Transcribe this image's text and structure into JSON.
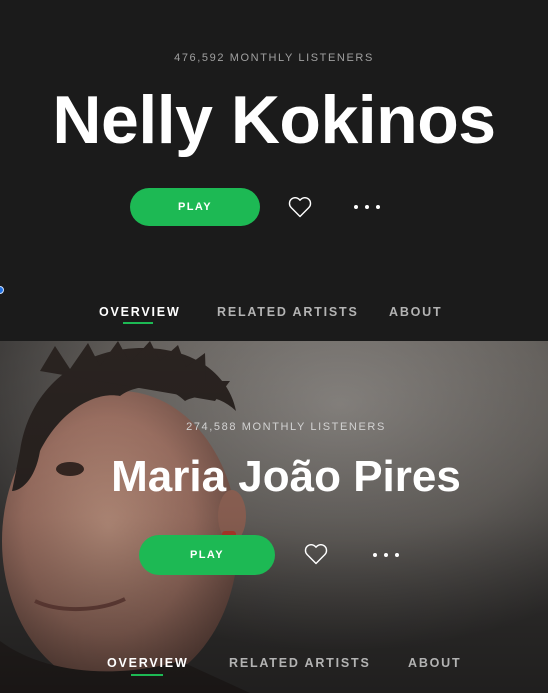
{
  "artists": [
    {
      "monthly_listeners": "476,592 MONTHLY LISTENERS",
      "name": "Nelly Kokinos",
      "play_label": "PLAY",
      "heart_icon": "heart-outline-icon",
      "more_icon": "more-dots-icon",
      "tabs": [
        {
          "label": "OVERVIEW",
          "active": true
        },
        {
          "label": "RELATED ARTISTS",
          "active": false
        },
        {
          "label": "ABOUT",
          "active": false
        }
      ]
    },
    {
      "monthly_listeners": "274,588 MONTHLY LISTENERS",
      "name": "Maria João Pires",
      "play_label": "PLAY",
      "heart_icon": "heart-outline-icon",
      "more_icon": "more-dots-icon",
      "tabs": [
        {
          "label": "OVERVIEW",
          "active": true
        },
        {
          "label": "RELATED ARTISTS",
          "active": false
        },
        {
          "label": "ABOUT",
          "active": false
        }
      ]
    }
  ],
  "colors": {
    "accent": "#1db954",
    "background": "#1b1b1b",
    "text_primary": "#ffffff",
    "text_secondary": "#b3b3b3"
  }
}
